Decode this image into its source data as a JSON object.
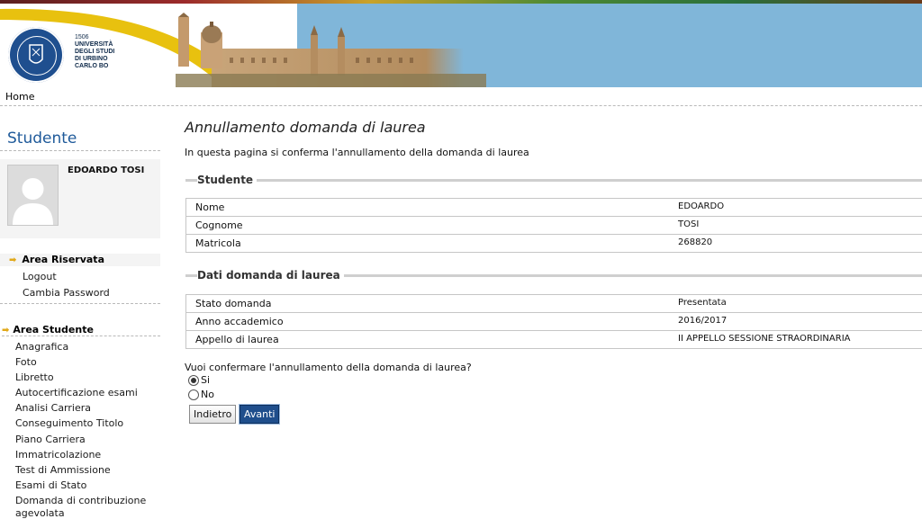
{
  "header": {
    "logo": {
      "year": "1506",
      "lines": [
        "UNIVERSITÀ",
        "DEGLI STUDI",
        "DI URBINO",
        "CARLO BO"
      ]
    },
    "colors": {
      "sky": "#80b6d9",
      "swoosh": "#e8c10f",
      "brand_blue": "#1f4f8f"
    }
  },
  "breadcrumb": {
    "home": "Home"
  },
  "sidebar": {
    "title": "Studente",
    "profile_name": "EDOARDO TOSI",
    "reserved": {
      "label": "Area Riservata",
      "items": [
        "Logout",
        "Cambia Password"
      ]
    },
    "student_area": {
      "label": "Area Studente",
      "items": [
        "Anagrafica",
        "Foto",
        "Libretto",
        "Autocertificazione esami",
        "Analisi Carriera",
        "Conseguimento Titolo",
        "Piano Carriera",
        "Immatricolazione",
        "Test di Ammissione",
        "Esami di Stato",
        "Domanda di contribuzione",
        "agevolata"
      ]
    }
  },
  "main": {
    "title": "Annullamento domanda di laurea",
    "description": "In questa pagina si conferma l'annullamento della domanda di laurea",
    "student_section": {
      "title": "Studente",
      "rows": [
        {
          "key": "Nome",
          "value": "EDOARDO"
        },
        {
          "key": "Cognome",
          "value": "TOSI"
        },
        {
          "key": "Matricola",
          "value": "268820"
        }
      ]
    },
    "application_section": {
      "title": "Dati domanda di laurea",
      "rows": [
        {
          "key": "Stato domanda",
          "value": "Presentata"
        },
        {
          "key": "Anno accademico",
          "value": "2016/2017"
        },
        {
          "key": "Appello di laurea",
          "value": "II APPELLO SESSIONE STRAORDINARIA"
        }
      ]
    },
    "question": "Vuoi confermare l'annullamento della domanda di laurea?",
    "options": [
      {
        "label": "Si",
        "selected": true
      },
      {
        "label": "No",
        "selected": false
      }
    ],
    "buttons": {
      "back": "Indietro",
      "next": "Avanti"
    }
  }
}
